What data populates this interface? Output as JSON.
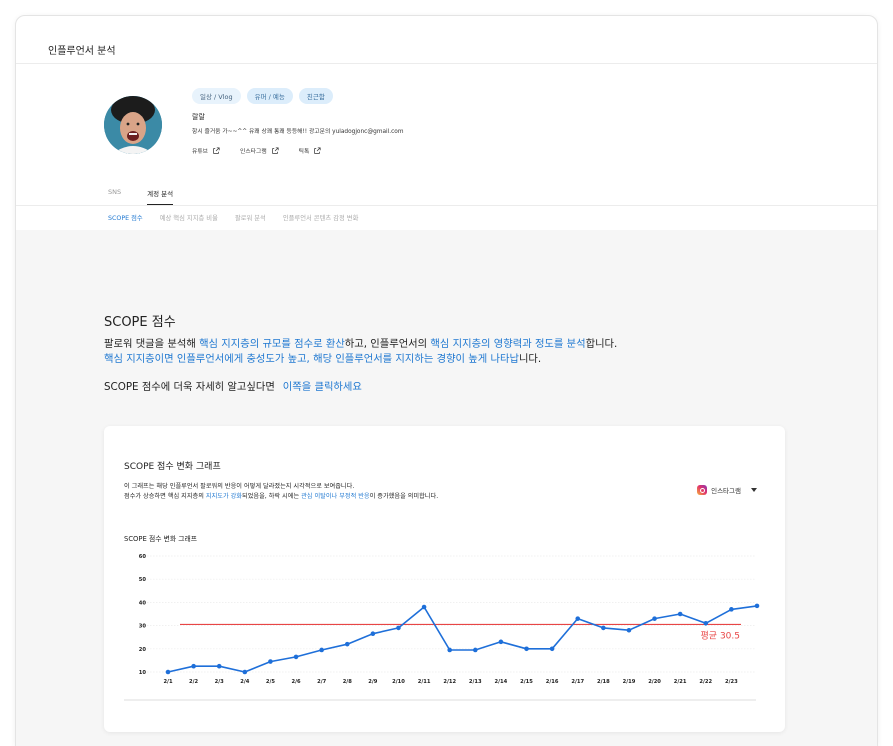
{
  "page": {
    "title": "인플루언서 분석"
  },
  "profile": {
    "tags": [
      "일상 / Vlog",
      "유머 / 예능",
      "친근함"
    ],
    "name": "랄랄",
    "description": "항시 즐거움 가~~^^ 유쾌 상쾌 통쾌 등등해!! 광고문의 yuladogjonc@gmail.com",
    "links": [
      {
        "label": "유튜브",
        "icon": "external-link-icon"
      },
      {
        "label": "인스타그램",
        "icon": "external-link-icon"
      },
      {
        "label": "틱톡",
        "icon": "external-link-icon"
      }
    ]
  },
  "tabs": {
    "items": [
      "SNS",
      "계정 분석"
    ],
    "active": "계정 분석"
  },
  "subtabs": {
    "items": [
      "SCOPE 점수",
      "예상 핵심 지지층 비율",
      "팔로워 분석",
      "인플루언서 콘텐츠 감정 변화"
    ],
    "active": "SCOPE 점수"
  },
  "scope": {
    "title": "SCOPE 점수",
    "desc1": [
      "팔로워 댓글을 분석해 ",
      "핵심 지지층의 규모를 점수로 환산",
      "하고, 인플루언서의 ",
      "핵심 지지층의 영향력과 정도를 분석",
      "합니다."
    ],
    "desc2": [
      "핵심 지지층이면 인플루언서에게 충성도가 높고, 해당 인플루언서를 지지하는 경향이 높게 나타납",
      "니다."
    ],
    "more_text": "SCOPE 점수에 더욱 자세히 알고싶다면",
    "more_link": "이쪽을 클릭하세요"
  },
  "card": {
    "title": "SCOPE 점수 변화 그래프",
    "desc1": "이 그래프는 해당 인플루언서 팔로워의 반응이 어떻게 달라졌는지 시각적으로 보여줍니다.",
    "desc2": [
      "점수가 상승하면 핵심 지지층의 ",
      "지지도가 강화",
      "되었음을, 하락 시에는 ",
      "관심 이탈이나 부정적 반응",
      "이 증가했음을 의미합니다."
    ],
    "platform": "인스타그램",
    "chart_title": "SCOPE 점수 변화 그래프"
  },
  "colors": {
    "accent": "#1f78d1",
    "line": "#1e6fd9",
    "average": "#e84545",
    "tag_bg": "#dcedfb"
  },
  "chart_data": {
    "type": "line",
    "x": [
      "2/1",
      "2/2",
      "2/3",
      "2/4",
      "2/5",
      "2/6",
      "2/7",
      "2/8",
      "2/9",
      "2/10",
      "2/11",
      "2/12",
      "2/13",
      "2/14",
      "2/15",
      "2/16",
      "2/17",
      "2/18",
      "2/19",
      "2/20",
      "2/21",
      "2/22",
      "2/23"
    ],
    "series": [
      {
        "values": [
          10,
          12.5,
          12.5,
          10,
          14.5,
          16.5,
          19.5,
          22,
          26.5,
          29,
          38,
          19.5,
          19.5,
          23,
          20,
          20,
          33,
          29,
          28,
          33,
          35,
          31,
          37,
          38.5
        ]
      }
    ],
    "average": {
      "value": 30.5,
      "label": "평균 30.5"
    },
    "ylim": [
      10,
      60
    ],
    "yticks": [
      10,
      20,
      30,
      40,
      50,
      60
    ],
    "grid": true
  }
}
